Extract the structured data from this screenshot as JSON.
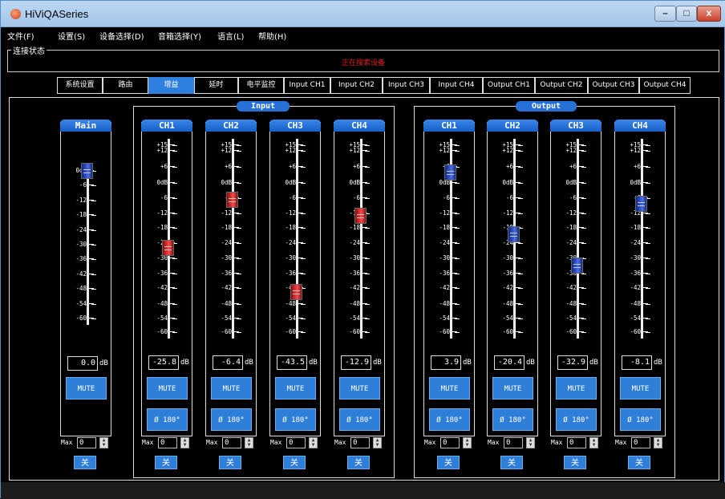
{
  "window": {
    "title": "HiViQASeries",
    "min": "–",
    "max": "□",
    "close": "x"
  },
  "menu": [
    "文件(F)",
    "设置(S)",
    "设备选择(D)",
    "音箱选择(Y)",
    "语言(L)",
    "帮助(H)"
  ],
  "status": {
    "legend": "连接状态",
    "text": "正在搜索设备"
  },
  "tabs": [
    "系统设置",
    "路由",
    "增益",
    "延时",
    "电平监控",
    "Input CH1",
    "Input CH2",
    "Input CH3",
    "Input CH4",
    "Output CH1",
    "Output CH2",
    "Output CH3",
    "Output CH4"
  ],
  "active_tab": 2,
  "groups": {
    "input": "Input",
    "output": "Output"
  },
  "labels": {
    "mute": "MUTE",
    "phase": "Ø 180°",
    "max": "Max",
    "off": "关",
    "db": "dB"
  },
  "scales": {
    "main": [
      "0dB",
      "-6",
      "-12",
      "-18",
      "-24",
      "-30",
      "-36",
      "-42",
      "-48",
      "-54",
      "-60"
    ],
    "channel": [
      "+15",
      "+12",
      "+6",
      "0dB",
      "-6",
      "-12",
      "-18",
      "-24",
      "-30",
      "-36",
      "-42",
      "-48",
      "-54",
      "-60"
    ]
  },
  "main": {
    "name": "Main",
    "gain": "0.0",
    "fader_db": 0,
    "color": "blue",
    "max": "0"
  },
  "inputs": [
    {
      "name": "CH1",
      "gain": "-25.8",
      "fader_db": -25.8,
      "color": "red",
      "max": "0"
    },
    {
      "name": "CH2",
      "gain": "-6.4",
      "fader_db": -6.4,
      "color": "red",
      "max": "0"
    },
    {
      "name": "CH3",
      "gain": "-43.5",
      "fader_db": -43.5,
      "color": "red",
      "max": "0"
    },
    {
      "name": "CH4",
      "gain": "-12.9",
      "fader_db": -12.9,
      "color": "red",
      "max": "0"
    }
  ],
  "outputs": [
    {
      "name": "CH1",
      "gain": "3.9",
      "fader_db": 3.9,
      "color": "blue",
      "max": "0"
    },
    {
      "name": "CH2",
      "gain": "-20.4",
      "fader_db": -20.4,
      "color": "blue",
      "max": "0"
    },
    {
      "name": "CH3",
      "gain": "-32.9",
      "fader_db": -32.9,
      "color": "blue",
      "max": "0"
    },
    {
      "name": "CH4",
      "gain": "-8.1",
      "fader_db": -8.1,
      "color": "blue",
      "max": "0"
    }
  ]
}
